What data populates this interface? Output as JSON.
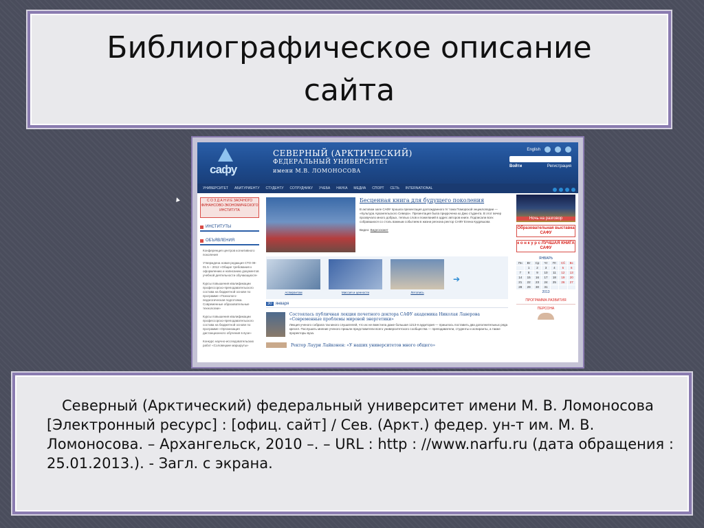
{
  "slide": {
    "title": "Библиографическое описание сайта",
    "citation": "Северный (Арктический) федеральный университет имени М. В. Ломоносова [Электронный ресурс] : [офиц. сайт] / Сев. (Аркт.) федер. ун-т им. М. В. Ломоносова. – Архангельск, 2010 –. – URL : http : //www.narfu.ru (дата обращения : 25.01.2013.). - Загл. с экрана."
  },
  "website": {
    "logo_text": "сафу",
    "name_line1": "СЕВЕРНЫЙ (АРКТИЧЕСКИЙ)",
    "name_line2": "ФЕДЕРАЛЬНЫЙ УНИВЕРСИТЕТ",
    "name_line3": "имени М.В. ЛОМОНОСОВА",
    "lang": "English",
    "login": "Войти",
    "register": "Регистрация",
    "nav": [
      "УНИВЕРСИТЕТ",
      "АБИТУРИЕНТУ",
      "СТУДЕНТУ",
      "СОТРУДНИКУ",
      "УЧЕБА",
      "НАУКА",
      "МЕДИА",
      "СПОРТ",
      "СЕТЬ",
      "INTERNATIONAL"
    ],
    "promo": "С О З Д А Н И Е ЗАОЧНОГО ФИНАНСОВО-ЭКОНОМИЧЕСКОГО ИНСТИТУТА",
    "institutes": "ИНСТИТУТЫ",
    "announcements": "ОБЪЯВЛЕНИЯ",
    "left_news": [
      "Конференция центров когнитивного поколения",
      "Утверждена новая редакция СТО 09-01.5 – 2012 «Общие требования к оформлению и написанию документов учебной деятельности обучающихся»",
      "Курсы повышения квалификации профессорско-преподавательского состава на бюджетной основе по программе «Психолого-педагогическая подготовка. Современные образовательные технологии»",
      "Курсы повышения квалификации профессорско-преподавательского состава на бюджетной основе по программе «Организация дистанционного обучения в вузе»",
      "Конкурс научно-исследовательских работ «Соловецкие маршруты»"
    ],
    "feature_title": "Бесценная книга для будущего поколения",
    "feature_body": "В актовом зале САФУ прошла презентация долгожданного IV тома Поморской энциклопедии — «Культура Архангельского Севера». Презентация была приурочена ко Дню студента. В этот вечер прозвучало много добрых, теплых слов и пожеланий в адрес авторов книги. Подписали всех собравшихся со столь важным событием в жизни региона ректор САФУ Елена Кудряшова",
    "feature_video_label": "Видео:",
    "feature_video_link": "Видеосюжет",
    "thumbs": [
      "Аспирантам",
      "Миссия и ценности",
      "Летопись"
    ],
    "date_num": "30",
    "date_month": "января",
    "news2_title": "Состоялась публичная лекция почетного доктора САФУ академика Николая Лаверова «Современные проблемы мировой энергетики»",
    "news2_body": "Лекция ученого собрала так много слушателей, что их не вместила даже большая 1213-я аудитория — пришлось поставить два дополнительных ряда кресел. Послушать мнение ученого пришли представители всего университетского сообщества — преподаватели, студенты и аспиранты, а также проректоры вуза.",
    "news3_title": "Ректор Лаури Лайконен: «У наших университетов много общего»",
    "night_label": "Ночь на разговор",
    "banner1": "Образовательная выставка САФУ",
    "banner2": "к о н к у р с ЛУЧШАЯ КНИГА САФУ",
    "calendar_month": "ЯНВАРЬ",
    "calendar_year": "2013",
    "calendar_head": [
      "Пн",
      "Вт",
      "Ср",
      "Чт",
      "Пт",
      "Сб",
      "Вс"
    ],
    "calendar_days": [
      "",
      "1",
      "2",
      "3",
      "4",
      "5",
      "6",
      "7",
      "8",
      "9",
      "10",
      "11",
      "12",
      "13",
      "14",
      "15",
      "16",
      "17",
      "18",
      "19",
      "20",
      "21",
      "22",
      "23",
      "24",
      "25",
      "26",
      "27",
      "28",
      "29",
      "30",
      "31",
      "",
      "",
      ""
    ],
    "program": "ПРОГРАММА РАЗВИТИЯ",
    "persona": "ПЕРСОНА"
  },
  "colors": {
    "frame": "#8a7bb0",
    "box_bg": "#e9e9ec",
    "page_bg": "#4a4d5c",
    "site_blue": "#1d4a8c",
    "site_red": "#d84b45"
  }
}
